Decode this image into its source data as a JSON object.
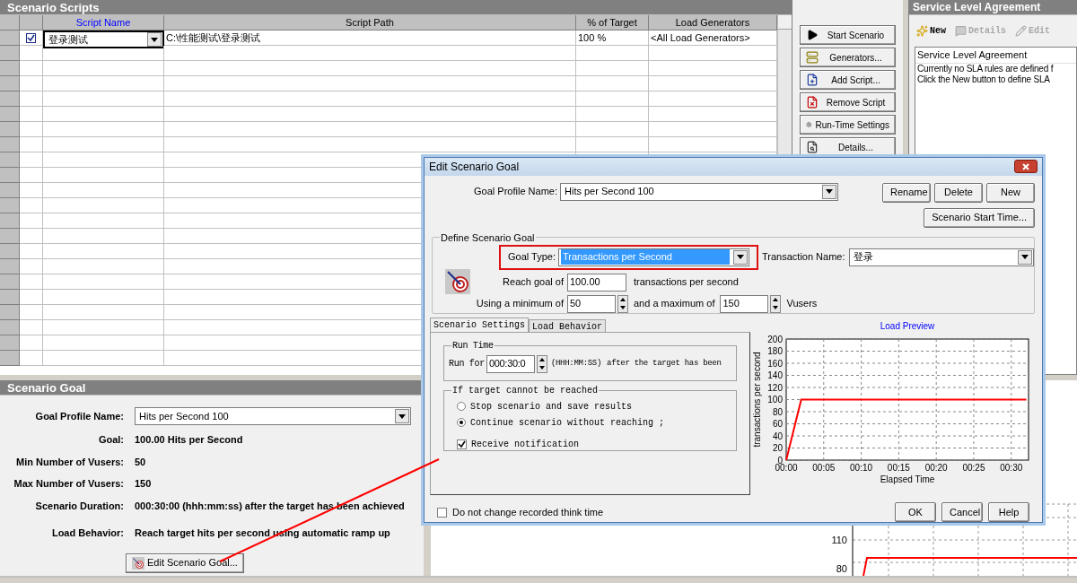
{
  "scripts_panel": {
    "title": "Scenario Scripts",
    "columns": [
      "Script Name",
      "Script Path",
      "% of Target",
      "Load Generators"
    ],
    "rows": [
      {
        "checked": true,
        "script_name": "登录测试",
        "script_path": "C:\\性能测试\\登录测试",
        "percent": "100 %",
        "load_generators": "<All Load Generators>"
      }
    ]
  },
  "script_buttons": [
    {
      "kind": "play",
      "label": "Start Scenario"
    },
    {
      "kind": "generators",
      "label": "Generators..."
    },
    {
      "kind": "add",
      "label": "Add Script..."
    },
    {
      "kind": "remove",
      "label": "Remove Script"
    },
    {
      "kind": "settings",
      "label": "Run-Time Settings"
    },
    {
      "kind": "details",
      "label": "Details..."
    }
  ],
  "sla_panel": {
    "title": "Service Level Agreement",
    "toolbar": [
      {
        "kind": "new",
        "label": "New",
        "disabled": false
      },
      {
        "kind": "details",
        "label": "Details",
        "disabled": true
      },
      {
        "kind": "edit",
        "label": "Edit",
        "disabled": true
      }
    ],
    "heading": "Service Level Agreement",
    "lines": [
      "Currently no SLA rules are defined f",
      "Click the New button to define SLA"
    ]
  },
  "goal_panel": {
    "title": "Scenario Goal",
    "profile_label": "Goal Profile Name:",
    "profile_value": "Hits per Second 100",
    "fields": [
      {
        "label": "Goal:",
        "value": "100.00 Hits per Second"
      },
      {
        "label": "Min Number of Vusers:",
        "value": "50"
      },
      {
        "label": "Max Number of Vusers:",
        "value": "150"
      },
      {
        "label": "Scenario Duration:",
        "value": "000:30:00 (hhh:mm:ss) after the target has been achieved"
      },
      {
        "label": "Load Behavior:",
        "value": "Reach target hits per second using automatic ramp up"
      }
    ],
    "edit_button": "Edit Scenario Goal..."
  },
  "background_chart": {
    "ticks": [
      "110",
      "80"
    ]
  },
  "dialog": {
    "title": "Edit Scenario Goal",
    "profile_label": "Goal Profile Name:",
    "profile_value": "Hits per Second 100",
    "buttons": [
      "Rename",
      "Delete",
      "New"
    ],
    "start_time_button": "Scenario Start Time...",
    "group_title": "Define Scenario Goal",
    "goal_type_label": "Goal Type:",
    "goal_type_value": "Transactions per Second",
    "transaction_label": "Transaction Name:",
    "transaction_value": "登录",
    "reach_label": "Reach goal of",
    "reach_value": "100.00",
    "reach_unit": "transactions per second",
    "min_label": "Using a minimum of",
    "min_value": "50",
    "max_label": "and a maximum of",
    "max_value": "150",
    "vusers_label": "Vusers",
    "tabs": [
      {
        "label": "Scenario Settings",
        "selected": true
      },
      {
        "label": "Load Behavior",
        "selected": false
      }
    ],
    "run_time": {
      "title": "Run Time",
      "run_for": "Run for",
      "value": "000:30:0",
      "format": "(HHH:MM:SS)",
      "after": "after the target has been"
    },
    "unreached": {
      "title": "If target cannot be reached",
      "options": [
        {
          "label": "Stop scenario and save results",
          "selected": false
        },
        {
          "label": "Continue scenario without reaching ;",
          "selected": true
        }
      ],
      "notify": {
        "label": "Receive notification",
        "checked": true
      }
    },
    "think_time": {
      "label": "Do not change recorded think time",
      "checked": false
    },
    "chart": {
      "chart_data": {
        "type": "line",
        "title": "Load Preview",
        "xlabel": "Elapsed Time",
        "ylabel": "transactions per second",
        "x": [
          0,
          2,
          32
        ],
        "series": [
          {
            "color": "#ff0000",
            "values": [
              0,
              100,
              100
            ]
          }
        ],
        "grid": true,
        "xlim": [
          0,
          32.3
        ],
        "ylim": [
          0,
          200
        ],
        "xticks": [
          {
            "value": 0,
            "label": "00:00"
          },
          {
            "value": 5,
            "label": "00:05"
          },
          {
            "value": 10,
            "label": "00:10"
          },
          {
            "value": 15,
            "label": "00:15"
          },
          {
            "value": 20,
            "label": "00:20"
          },
          {
            "value": 25,
            "label": "00:25"
          },
          {
            "value": 30,
            "label": "00:30"
          }
        ],
        "yticks": [
          0,
          20,
          40,
          60,
          80,
          100,
          120,
          140,
          160,
          180,
          200
        ]
      }
    },
    "footer_buttons": [
      "OK",
      "Cancel",
      "Help"
    ]
  }
}
